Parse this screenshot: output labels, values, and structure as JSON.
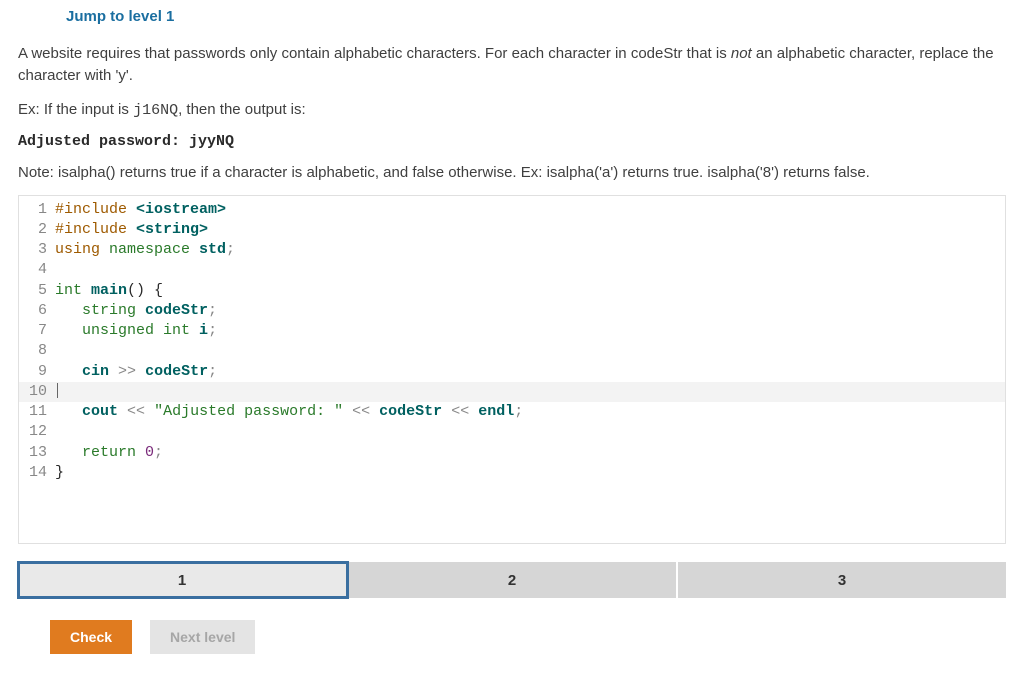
{
  "header": {
    "jump_link": "Jump to level 1"
  },
  "problem": {
    "desc_pre": "A website requires that passwords only contain alphabetic characters. For each character in codeStr that is ",
    "desc_em": "not",
    "desc_post": " an alphabetic character, replace the character with 'y'.",
    "ex_pre": "Ex: If the input is ",
    "ex_code": "j16NQ",
    "ex_post": ", then the output is:",
    "output": "Adjusted password: jyyNQ",
    "note": "Note: isalpha() returns true if a character is alphabetic, and false otherwise. Ex: isalpha('a') returns true. isalpha('8') returns false."
  },
  "code": {
    "lines": [
      {
        "n": "1",
        "hl": false,
        "seg": [
          [
            "pp",
            "#include "
          ],
          [
            "hdr",
            "<iostream>"
          ]
        ]
      },
      {
        "n": "2",
        "hl": false,
        "seg": [
          [
            "pp",
            "#include "
          ],
          [
            "hdr",
            "<string>"
          ]
        ]
      },
      {
        "n": "3",
        "hl": false,
        "seg": [
          [
            "pp",
            "using "
          ],
          [
            "kw",
            "namespace "
          ],
          [
            "id",
            "std"
          ],
          [
            "op",
            ";"
          ]
        ]
      },
      {
        "n": "4",
        "hl": false,
        "seg": []
      },
      {
        "n": "5",
        "hl": false,
        "seg": [
          [
            "kw",
            "int "
          ],
          [
            "id",
            "main"
          ],
          [
            "pl",
            "() {"
          ]
        ]
      },
      {
        "n": "6",
        "hl": false,
        "seg": [
          [
            "pl",
            "   "
          ],
          [
            "kw",
            "string "
          ],
          [
            "id",
            "codeStr"
          ],
          [
            "op",
            ";"
          ]
        ]
      },
      {
        "n": "7",
        "hl": false,
        "seg": [
          [
            "pl",
            "   "
          ],
          [
            "kw",
            "unsigned int "
          ],
          [
            "id",
            "i"
          ],
          [
            "op",
            ";"
          ]
        ]
      },
      {
        "n": "8",
        "hl": false,
        "seg": []
      },
      {
        "n": "9",
        "hl": false,
        "seg": [
          [
            "pl",
            "   "
          ],
          [
            "id",
            "cin"
          ],
          [
            "pl",
            " "
          ],
          [
            "op",
            ">>"
          ],
          [
            "pl",
            " "
          ],
          [
            "id",
            "codeStr"
          ],
          [
            "op",
            ";"
          ]
        ]
      },
      {
        "n": "10",
        "hl": true,
        "cursor": true,
        "seg": []
      },
      {
        "n": "11",
        "hl": false,
        "seg": [
          [
            "pl",
            "   "
          ],
          [
            "id",
            "cout"
          ],
          [
            "pl",
            " "
          ],
          [
            "op",
            "<<"
          ],
          [
            "pl",
            " "
          ],
          [
            "str",
            "\"Adjusted password: \""
          ],
          [
            "pl",
            " "
          ],
          [
            "op",
            "<<"
          ],
          [
            "pl",
            " "
          ],
          [
            "id",
            "codeStr"
          ],
          [
            "pl",
            " "
          ],
          [
            "op",
            "<<"
          ],
          [
            "pl",
            " "
          ],
          [
            "id",
            "endl"
          ],
          [
            "op",
            ";"
          ]
        ]
      },
      {
        "n": "12",
        "hl": false,
        "seg": []
      },
      {
        "n": "13",
        "hl": false,
        "seg": [
          [
            "pl",
            "   "
          ],
          [
            "kw",
            "return "
          ],
          [
            "num",
            "0"
          ],
          [
            "op",
            ";"
          ]
        ]
      },
      {
        "n": "14",
        "hl": false,
        "seg": [
          [
            "pl",
            "}"
          ]
        ]
      }
    ]
  },
  "levels": {
    "tabs": [
      "1",
      "2",
      "3"
    ],
    "active_index": 0
  },
  "buttons": {
    "check": "Check",
    "next": "Next level"
  }
}
